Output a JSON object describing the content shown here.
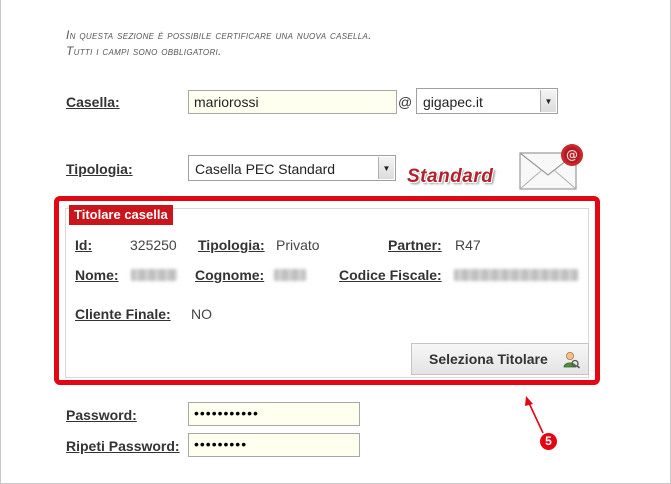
{
  "intro": {
    "line1": "In questa sezione è possibile certificare una nuova casella.",
    "line2": "Tutti i campi sono obbligatori."
  },
  "casella": {
    "label": "Casella:",
    "value": "mariorossi",
    "at": "@",
    "domain": "gigapec.it"
  },
  "tipologia": {
    "label": "Tipologia:",
    "value": "Casella PEC Standard",
    "badge": "Standard"
  },
  "titolare": {
    "legend": "Titolare casella",
    "id_label": "Id:",
    "id_value": "325250",
    "tipologia_label": "Tipologia:",
    "tipologia_value": "Privato",
    "partner_label": "Partner:",
    "partner_value": "R47",
    "nome_label": "Nome:",
    "cognome_label": "Cognome:",
    "codice_fiscale_label": "Codice Fiscale:",
    "cliente_finale_label": "Cliente Finale:",
    "cliente_finale_value": "NO",
    "select_button": "Seleziona Titolare"
  },
  "password": {
    "label": "Password:",
    "value": "•••••••••••",
    "repeat_label": "Ripeti Password:",
    "repeat_value": "•••••••••"
  },
  "callout": {
    "number": "5",
    "color": "#e30613"
  },
  "colors": {
    "highlight": "#e30613",
    "legend_bg": "#c9161d",
    "field_bg": "#fffff0"
  }
}
